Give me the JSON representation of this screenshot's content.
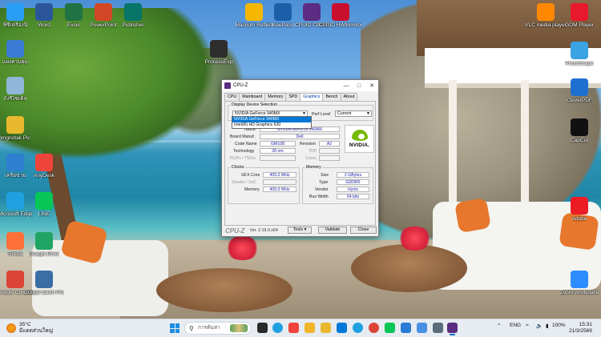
{
  "desktop": {
    "left_icons": [
      {
        "label": "พีซีเครื่องนี้",
        "icon": "this-pc-icon",
        "color": "#2a9df4"
      },
      {
        "label": "Word",
        "icon": "word-icon",
        "color": "#2b579a"
      },
      {
        "label": "Excel",
        "icon": "excel-icon",
        "color": "#217346"
      },
      {
        "label": "PowerPoint",
        "icon": "powerpoint-icon",
        "color": "#d24726"
      },
      {
        "label": "Publisher",
        "icon": "publisher-icon",
        "color": "#077568"
      },
      {
        "label": "แผงควบคุม",
        "icon": "control-panel-icon",
        "color": "#3a7bd5"
      },
      {
        "label": "ถังรีไซเคิล",
        "icon": "recycle-bin-icon",
        "color": "#8fb7d9"
      },
      {
        "label": "Imgnotak Pic",
        "icon": "folder-icon",
        "color": "#e8b92f"
      },
      {
        "label": "เครือข่าย",
        "icon": "network-icon",
        "color": "#2f7fd0"
      },
      {
        "label": "AnyDesk",
        "icon": "anydesk-icon",
        "color": "#ef443b"
      },
      {
        "label": "Microsoft Edge",
        "icon": "edge-icon",
        "color": "#1fa0e0"
      },
      {
        "label": "LINE",
        "icon": "line-icon",
        "color": "#06c755"
      },
      {
        "label": "Firefox",
        "icon": "firefox-icon",
        "color": "#ff7139"
      },
      {
        "label": "Google Drive",
        "icon": "google-drive-icon",
        "color": "#1fa463"
      },
      {
        "label": "Google Chrome",
        "icon": "chrome-icon",
        "color": "#db4437"
      },
      {
        "label": "Google Earth Pro",
        "icon": "google-earth-icon",
        "color": "#3b6ea5"
      }
    ],
    "top_icons": [
      {
        "label": "Macrium Reflect",
        "icon": "macrium-icon",
        "color": "#f5b700"
      },
      {
        "label": "KeePass",
        "icon": "keepass-icon",
        "color": "#1b5fa8"
      },
      {
        "label": "CPUID CPU-Z",
        "icon": "cpuz-icon",
        "color": "#5a2d82"
      },
      {
        "label": "CPUID HWMonitor",
        "icon": "hwmonitor-icon",
        "color": "#c8102e"
      },
      {
        "label": "ProcessExp",
        "icon": "process-icon",
        "color": "#2d2d2d"
      }
    ],
    "right_icons": [
      {
        "label": "VLC media player",
        "icon": "vlc-icon",
        "color": "#ff8800"
      },
      {
        "label": "GOM Player",
        "icon": "gom-player-icon",
        "color": "#e8192c"
      },
      {
        "label": "PhotoScape",
        "icon": "photoscape-icon",
        "color": "#3aa3e3"
      },
      {
        "label": "CleverPDF",
        "icon": "cleverpdf-icon",
        "color": "#1f6fd1"
      },
      {
        "label": "CapCut",
        "icon": "capcut-icon",
        "color": "#111111"
      },
      {
        "label": "Adobe",
        "icon": "adobe-icon",
        "color": "#ec1c24"
      },
      {
        "label": "Zoom Workplace",
        "icon": "zoom-icon",
        "color": "#2d8cff"
      }
    ]
  },
  "cpuz": {
    "title": "CPU-Z",
    "tabs": [
      "CPU",
      "Mainboard",
      "Memory",
      "SPD",
      "Graphics",
      "Bench",
      "About"
    ],
    "active_tab": "Graphics",
    "display_selection": {
      "title": "Display Device Selection",
      "device": "NVIDIA GeForce 940MX",
      "perf_label": "Perf Level",
      "perf_value": "Current",
      "options": [
        "NVIDIA GeForce 940MX",
        "Intel(R) HD Graphics 620"
      ]
    },
    "gpu": {
      "name_label": "Name",
      "name": "NVIDIA GeForce 940MX",
      "board_label": "Board Manuf.",
      "board": "Dell",
      "code_label": "Code Name",
      "code": "GM108",
      "revision_label": "Revision",
      "revision": "A2",
      "tech_label": "Technology",
      "tech": "28 nm",
      "tdp_label": "TDP",
      "rops_label": "ROPs / TMUs",
      "cores_label": "Cores",
      "logo_text": "NVIDIA."
    },
    "clocks": {
      "title": "Clocks",
      "gfx_label": "GFX Core",
      "gfx": "405.0 MHz",
      "shader_label": "Shader / SoC",
      "mem_label": "Memory",
      "mem": "405.0 MHz"
    },
    "memory": {
      "title": "Memory",
      "size_label": "Size",
      "size": "2 GBytes",
      "type_label": "Type",
      "type": "GDDR5",
      "vendor_label": "Vendor",
      "vendor": "Hynix",
      "bus_label": "Bus Width",
      "bus": "64 bits"
    },
    "footer": {
      "brand": "CPU-Z",
      "version": "Ver. 2.19.0.x64",
      "tools": "Tools",
      "validate": "Validate",
      "close": "Close"
    }
  },
  "taskbar": {
    "weather_temp": "35°C",
    "weather_text": "มีแดดส่วนใหญ่",
    "search_placeholder": "การค้นหา",
    "language": "ENG",
    "battery": "100%",
    "time": "15:31",
    "date": "21/3/2569"
  }
}
